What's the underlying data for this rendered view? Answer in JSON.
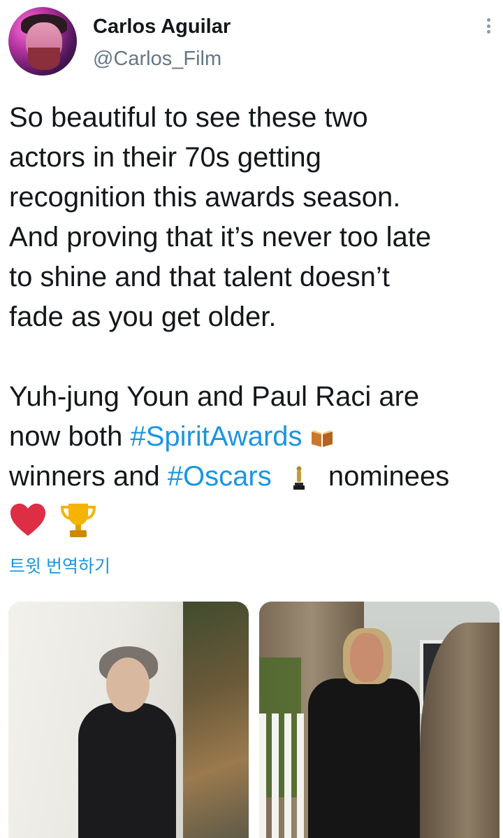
{
  "tweet": {
    "author_name": "Carlos Aguilar",
    "author_handle": "@Carlos_Film",
    "para1": [
      "So beautiful to see these two",
      "actors in their 70s getting",
      "recognition this awards season.",
      "And proving that it’s never too late",
      "to shine and that talent doesn’t",
      "fade as you get older."
    ],
    "para2_line1": "Yuh-jung Youn and Paul Raci are",
    "para2_line2_text": "now both ",
    "hashtag1": "#SpiritAwards",
    "para2_line3_text": "winners and ",
    "hashtag2": "#Oscars",
    "para2_line3_tail": "nominees",
    "translate_label": "트윗 번역하기"
  },
  "icons": {
    "avatar": "avatar-photo",
    "more": "more-vertical-icon",
    "spirit_emoji": "book-emoji",
    "oscar_emoji": "oscar-statue-emoji",
    "heart_emoji": "red-heart-emoji",
    "trophy_emoji": "trophy-emoji"
  },
  "colors": {
    "link": "#1b95e0",
    "secondary": "#657786",
    "text": "#14171a"
  }
}
